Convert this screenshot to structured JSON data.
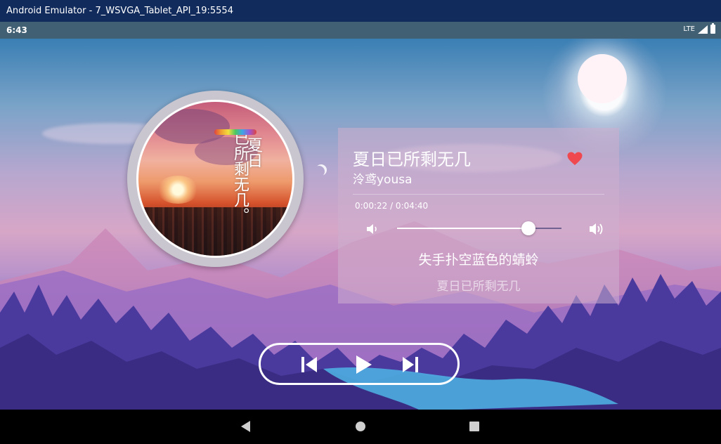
{
  "window": {
    "title": "Android Emulator - 7_WSVGA_Tablet_API_19:5554"
  },
  "status_bar": {
    "time": "6:43",
    "network": "LTE",
    "icons": [
      "signal-icon",
      "battery-icon"
    ]
  },
  "player": {
    "song_title": "夏日已所剩无几",
    "artist": "泠鸢yousa",
    "favorited": true,
    "time_display": "0:00:22 / 0:04:40",
    "volume_fraction": 0.8,
    "lyrics": {
      "current": "失手扑空蓝色的蜻蛉",
      "next": "夏日已所剩无几"
    },
    "album_art_text": {
      "column_a": "夏日",
      "column_b": "已所剩无几。"
    },
    "controls": [
      "previous-icon",
      "play-icon",
      "next-icon"
    ]
  },
  "navigation": {
    "buttons": [
      "back-icon",
      "home-icon",
      "recents-icon"
    ]
  },
  "colors": {
    "heart": "#f0484f",
    "title_bar": "#112b5c",
    "status_bar": "#426074"
  }
}
